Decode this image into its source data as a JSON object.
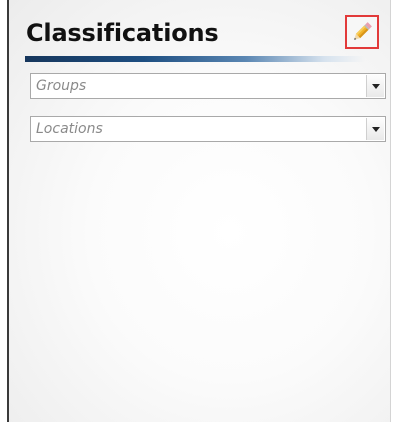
{
  "panel": {
    "title": "Classifications",
    "accent_color": "#1e4f82",
    "edit_button": {
      "icon": "pencil-icon",
      "highlight_color": "#e23a3a"
    }
  },
  "filters": {
    "groups": {
      "placeholder": "Groups"
    },
    "locations": {
      "placeholder": "Locations"
    }
  }
}
